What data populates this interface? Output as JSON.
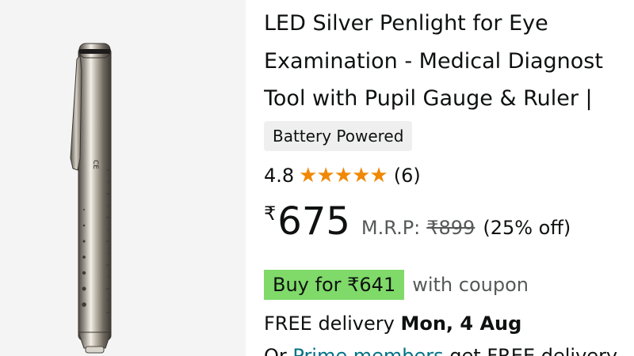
{
  "product_image": {
    "alt": "LED silver penlight"
  },
  "product": {
    "title_lines": [
      "LED Silver Penlight for Eye",
      "Examination - Medical Diagnost",
      "Tool with Pupil Gauge & Ruler |"
    ],
    "badge": "Battery Powered",
    "rating": "4.8",
    "stars": 5,
    "rating_count": "(6)",
    "currency": "₹",
    "price": "675",
    "mrp_label": "M.R.P:",
    "mrp_value": "₹899",
    "discount": "(25% off)",
    "coupon_label": "Buy for ₹641",
    "coupon_text": "with coupon",
    "delivery_prefix": "FREE delivery ",
    "delivery_date": "Mon, 4 Aug",
    "prime_prefix": "Or ",
    "prime_link": "Prime members",
    "prime_suffix": " get FREE delivery"
  },
  "colors": {
    "star": "#f08804",
    "coupon_bg": "#7fda69",
    "link": "#007185",
    "muted": "#565959"
  },
  "icons": {
    "star": "star-icon"
  }
}
